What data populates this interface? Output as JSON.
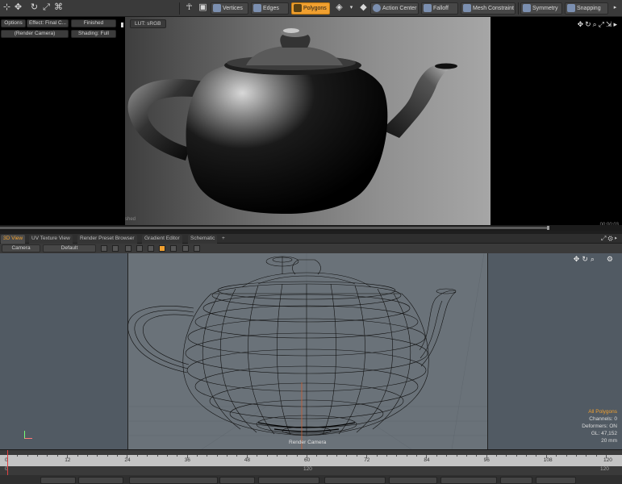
{
  "toolbar": {
    "vertices": "Vertices",
    "edges": "Edges",
    "polygons": "Polygons",
    "action_center": "Action Center",
    "falloff": "Falloff",
    "mesh_constraint": "Mesh Constraint",
    "symmetry": "Symmetry",
    "snapping": "Snapping"
  },
  "render": {
    "options": "Options",
    "effect": "Effect: Final C...",
    "finished": "Finished",
    "render_camera": "(Render Camera)",
    "shading": "Shading: Full",
    "lut": "LUT: sRGB",
    "status_left": "shed",
    "time": "00:00:03",
    "progress": 0.88
  },
  "tabs": [
    "3D View",
    "UV Texture View",
    "Render Preset Browser",
    "Gradient Editor",
    "Schematic",
    "+"
  ],
  "viewport": {
    "camera": "Camera",
    "style": "Default",
    "stats": {
      "mode": "All Polygons",
      "channels": "Channels: 0",
      "deformers": "Deformers: ON",
      "gl": "GL: 47,152",
      "focal": "20 mm"
    },
    "camera_label": "Render Camera"
  },
  "timeline": {
    "ticks": [
      "0",
      "12",
      "24",
      "36",
      "48",
      "60",
      "72",
      "84",
      "96",
      "108",
      "120"
    ],
    "sub_left": "0",
    "sub_mid": "120",
    "sub_right": "120"
  }
}
